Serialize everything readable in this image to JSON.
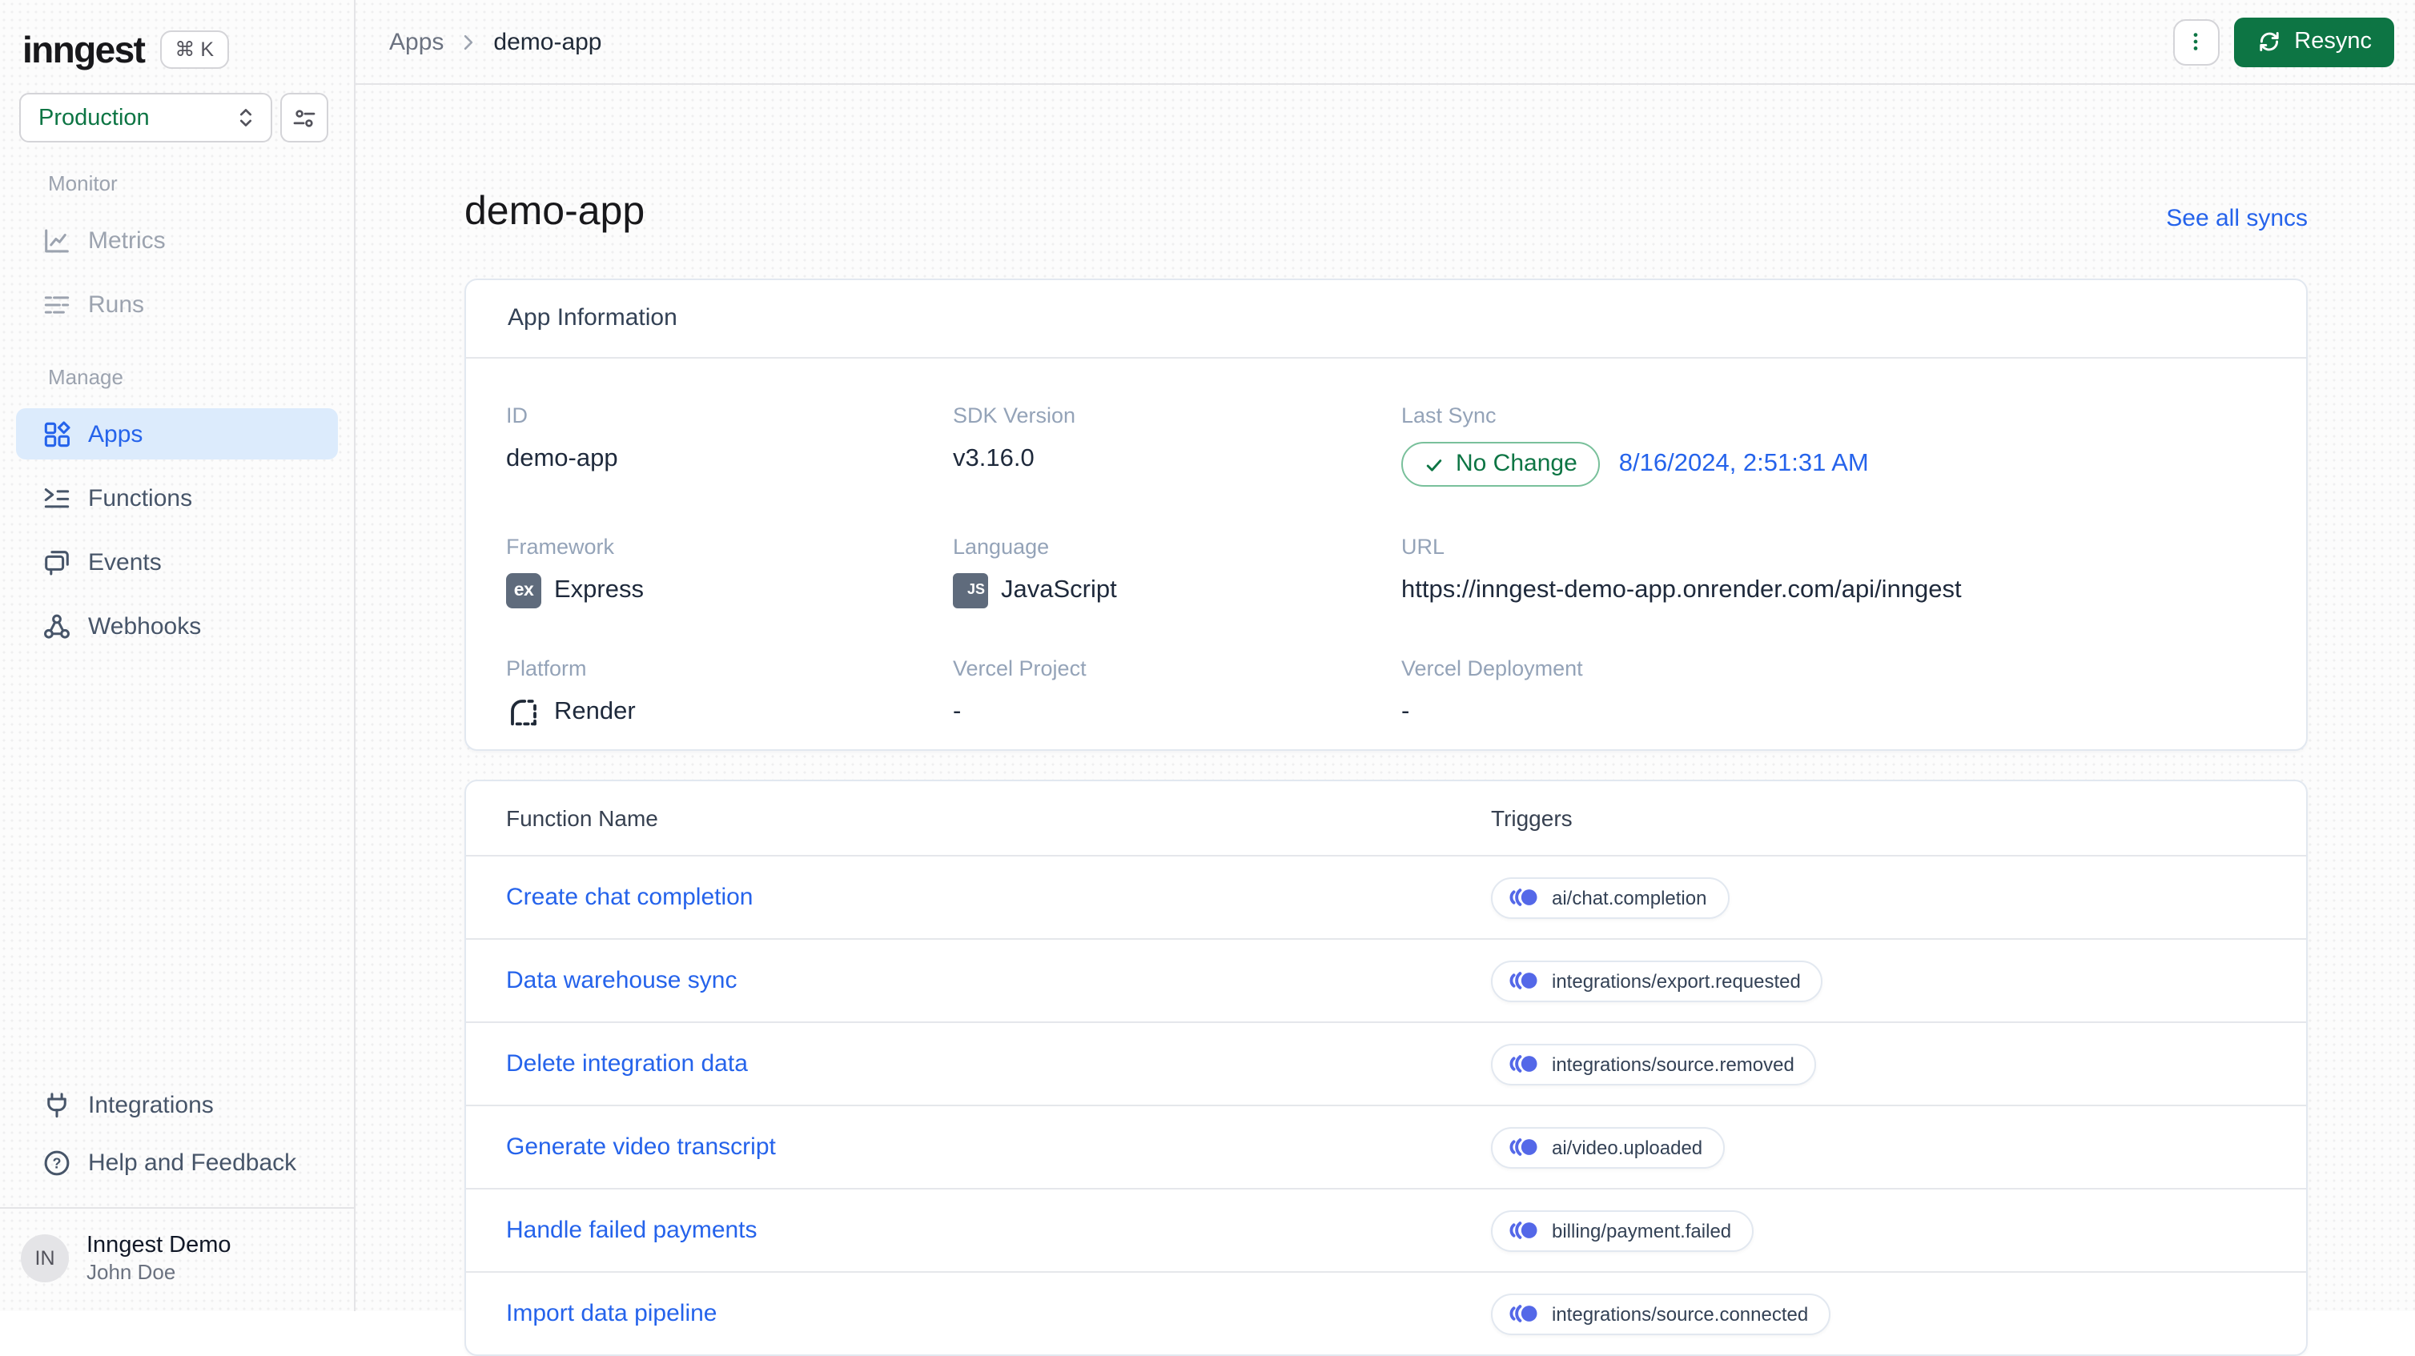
{
  "sidebar": {
    "logo": "inngest",
    "shortcut": "⌘ K",
    "environment": "Production",
    "sections": [
      {
        "label": "Monitor",
        "items": [
          {
            "label": "Metrics"
          },
          {
            "label": "Runs"
          }
        ]
      },
      {
        "label": "Manage",
        "items": [
          {
            "label": "Apps"
          },
          {
            "label": "Functions"
          },
          {
            "label": "Events"
          },
          {
            "label": "Webhooks"
          }
        ]
      }
    ],
    "footer": {
      "items": [
        {
          "label": "Integrations"
        },
        {
          "label": "Help and Feedback"
        }
      ],
      "user": {
        "initials": "IN",
        "org": "Inngest Demo",
        "name": "John Doe"
      }
    }
  },
  "topbar": {
    "breadcrumb": [
      "Apps",
      "demo-app"
    ],
    "resync": "Resync"
  },
  "page": {
    "title": "demo-app",
    "see_all_syncs": "See all syncs",
    "app_info": {
      "title": "App Information",
      "id_label": "ID",
      "id": "demo-app",
      "sdk_label": "SDK Version",
      "sdk": "v3.16.0",
      "last_sync_label": "Last Sync",
      "sync_status": "No Change",
      "sync_time": "8/16/2024, 2:51:31 AM",
      "framework_label": "Framework",
      "framework": "Express",
      "framework_badge": "ex",
      "language_label": "Language",
      "language": "JavaScript",
      "language_badge": "JS",
      "url_label": "URL",
      "url": "https://inngest-demo-app.onrender.com/api/inngest",
      "platform_label": "Platform",
      "platform": "Render",
      "vercel_project_label": "Vercel Project",
      "vercel_project": "-",
      "vercel_deployment_label": "Vercel Deployment",
      "vercel_deployment": "-"
    },
    "functions": {
      "col_name": "Function Name",
      "col_triggers": "Triggers",
      "rows": [
        {
          "name": "Create chat completion",
          "trigger": "ai/chat.completion"
        },
        {
          "name": "Data warehouse sync",
          "trigger": "integrations/export.requested"
        },
        {
          "name": "Delete integration data",
          "trigger": "integrations/source.removed"
        },
        {
          "name": "Generate video transcript",
          "trigger": "ai/video.uploaded"
        },
        {
          "name": "Handle failed payments",
          "trigger": "billing/payment.failed"
        },
        {
          "name": "Import data pipeline",
          "trigger": "integrations/source.connected"
        }
      ]
    }
  },
  "colors": {
    "accent_green": "#0d7544",
    "link_blue": "#2563eb",
    "trigger_blue": "#5468e8",
    "active_nav_bg": "#dcebfc"
  }
}
